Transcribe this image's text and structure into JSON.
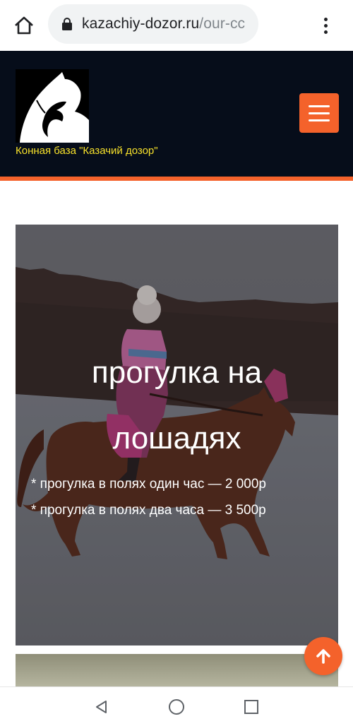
{
  "browser": {
    "url_domain": "kazachiy-dozor.ru",
    "url_path": "/our-cc"
  },
  "header": {
    "brand_name": "Конная база \"Казачий дозор\"",
    "accent_color": "#f4622b",
    "brand_color": "#f7e12b"
  },
  "hero": {
    "title_line1": "прогулка на",
    "title_line2": "лошадях",
    "prices": [
      "* прогулка в полях один час — 2 000р",
      "* прогулка в полях два часа — 3 500р"
    ]
  },
  "icons": {
    "home": "home-icon",
    "lock": "lock-icon",
    "more": "more-vert-icon",
    "menu": "hamburger-menu-icon",
    "scroll_top": "arrow-up-icon",
    "nav_back": "triangle-back-icon",
    "nav_home": "circle-home-icon",
    "nav_recent": "square-recent-icon"
  }
}
